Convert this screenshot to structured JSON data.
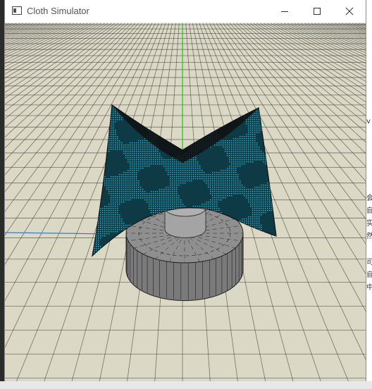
{
  "window": {
    "title": "Cloth Simulator",
    "icon": "app-window-icon",
    "controls": {
      "minimize": "minimize-icon",
      "maximize": "maximize-icon",
      "close": "close-icon"
    }
  },
  "viewport": {
    "ground_color": "#dcd8c6",
    "grid_color": "#1f1f1f",
    "cloth_color": "#2ab8d4",
    "cloth_edge_color": "#111111",
    "cylinder_color": "#8f8f8f",
    "y_axis_color": "#1fc21f",
    "x_axis_color": "#2f7fd6"
  },
  "desktop_glyphs": [
    "v",
    "会",
    "自",
    "实",
    "然",
    "司",
    "自",
    "中"
  ]
}
